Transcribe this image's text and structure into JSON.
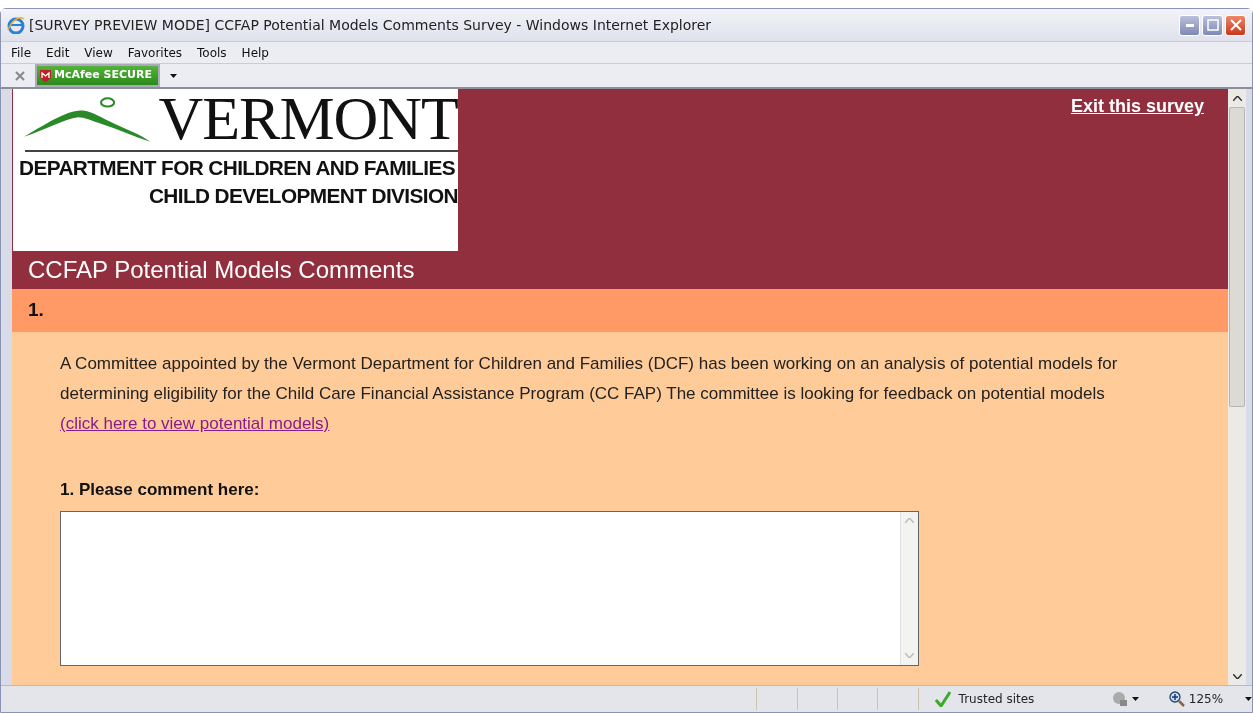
{
  "window": {
    "title": "[SURVEY PREVIEW MODE] CCFAP Potential Models Comments Survey - Windows Internet Explorer"
  },
  "menu": [
    "File",
    "Edit",
    "View",
    "Favorites",
    "Tools",
    "Help"
  ],
  "toolbar": {
    "badge": "McAfee SECURE"
  },
  "header": {
    "logo_name": "VERMONT",
    "logo_line_1": "DEPARTMENT FOR CHILDREN AND FAMILIES",
    "logo_line_2": "CHILD DEVELOPMENT DIVISION",
    "exit_link": "Exit this survey",
    "survey_title": "CCFAP Potential Models Comments"
  },
  "page": {
    "number": "1.",
    "intro": "A Committee appointed by the Vermont Department for Children and Families (DCF) has been working on an analysis of potential models for determining eligibility for the Child Care Financial Assistance Program (CC FAP) The committee is looking for feedback on potential models",
    "link": "(click here to view potential models)"
  },
  "question": {
    "label": "1. Please comment here:"
  },
  "status_bar": {
    "zone": "Trusted sites",
    "zoom": "125%"
  }
}
